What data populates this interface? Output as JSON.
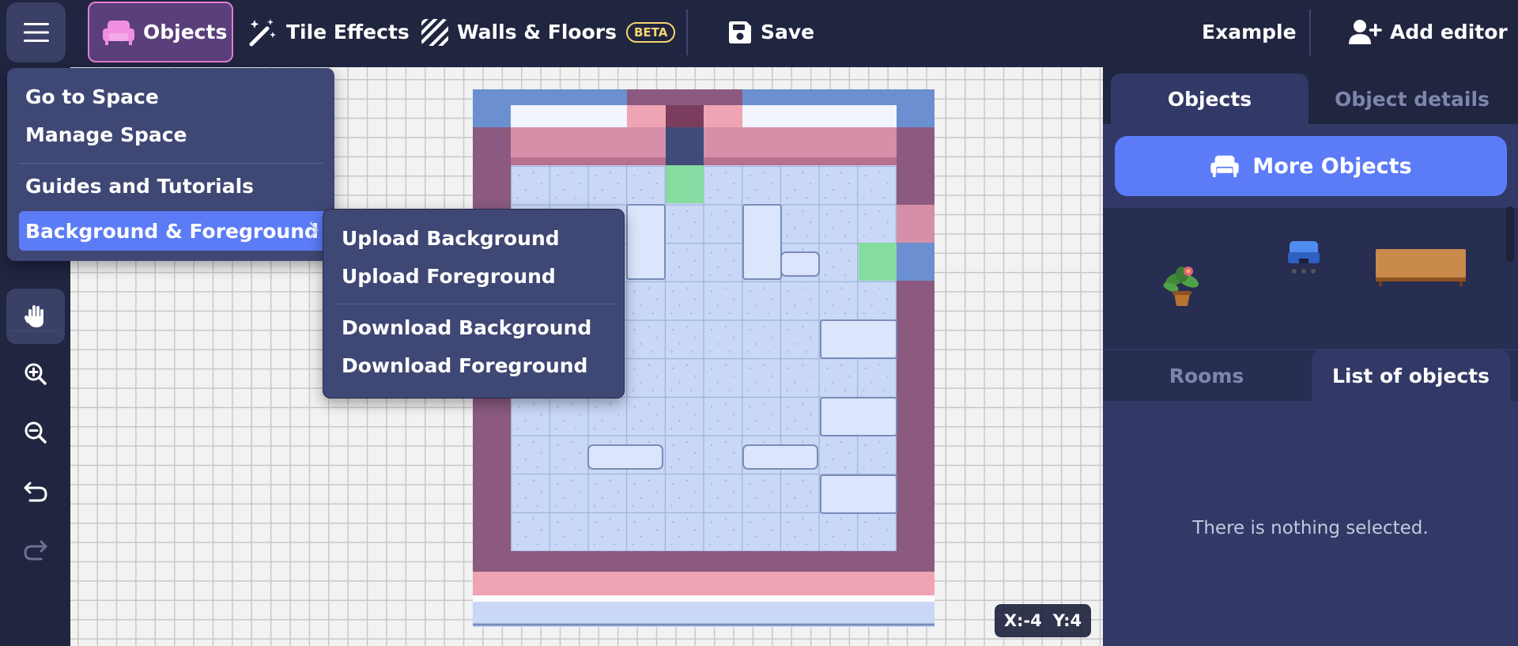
{
  "toolbar": {
    "objects": "Objects",
    "tile_effects": "Tile Effects",
    "walls_floors": "Walls & Floors",
    "beta": "BETA",
    "save": "Save",
    "example": "Example",
    "add_editor": "Add editor"
  },
  "main_menu": {
    "items": [
      "Go to Space",
      "Manage Space",
      "Guides and Tutorials",
      "Background & Foreground"
    ]
  },
  "submenu": {
    "items": [
      "Upload Background",
      "Upload Foreground",
      "Download Background",
      "Download Foreground"
    ]
  },
  "coords": {
    "x": "X:-4",
    "y": "Y:4"
  },
  "right_panel": {
    "tabs_top": [
      "Objects",
      "Object details"
    ],
    "more_objects": "More Objects",
    "tabs_mid": [
      "Rooms",
      "List of objects"
    ],
    "empty_text": "There is nothing selected."
  },
  "colors": {
    "accent": "#5b7cf6",
    "objects_active_bg": "#5a3f7a",
    "objects_active_border": "#e07fd0",
    "beta": "#f5d470",
    "background": "#202540",
    "panel": "#323966"
  }
}
